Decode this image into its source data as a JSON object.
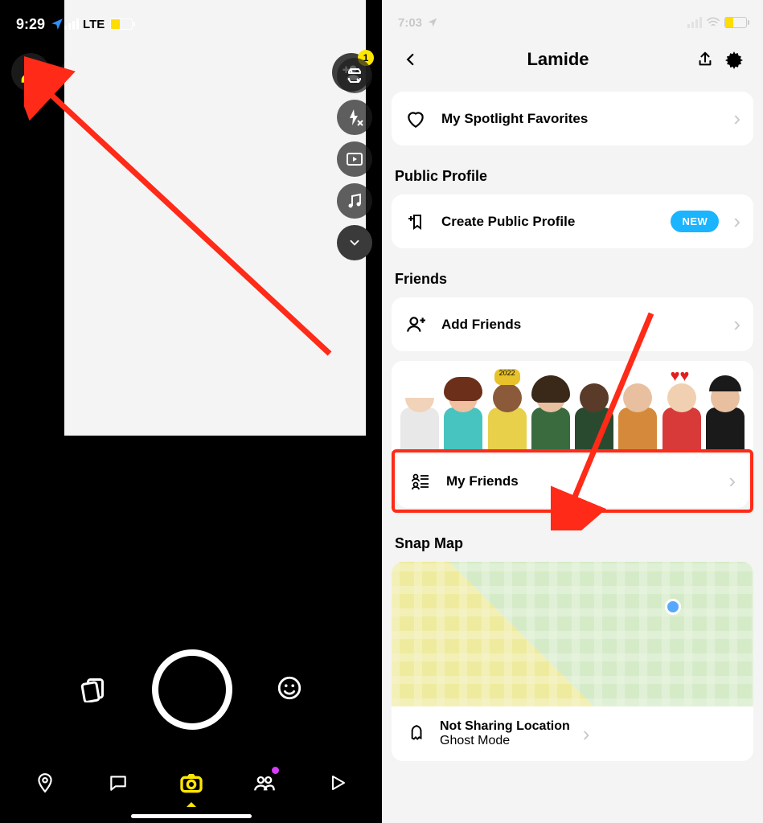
{
  "left": {
    "status": {
      "time": "9:29",
      "network": "LTE"
    },
    "badge": "1"
  },
  "right": {
    "status": {
      "time": "7:03"
    },
    "header": {
      "title": "Lamide"
    },
    "spotlight": {
      "label": "My Spotlight Favorites"
    },
    "public_profile": {
      "section": "Public Profile",
      "create": "Create Public Profile",
      "new": "NEW"
    },
    "friends": {
      "section": "Friends",
      "add": "Add Friends",
      "my": "My Friends"
    },
    "snapmap": {
      "section": "Snap Map",
      "loc_title": "Not Sharing Location",
      "loc_sub": "Ghost Mode"
    }
  }
}
